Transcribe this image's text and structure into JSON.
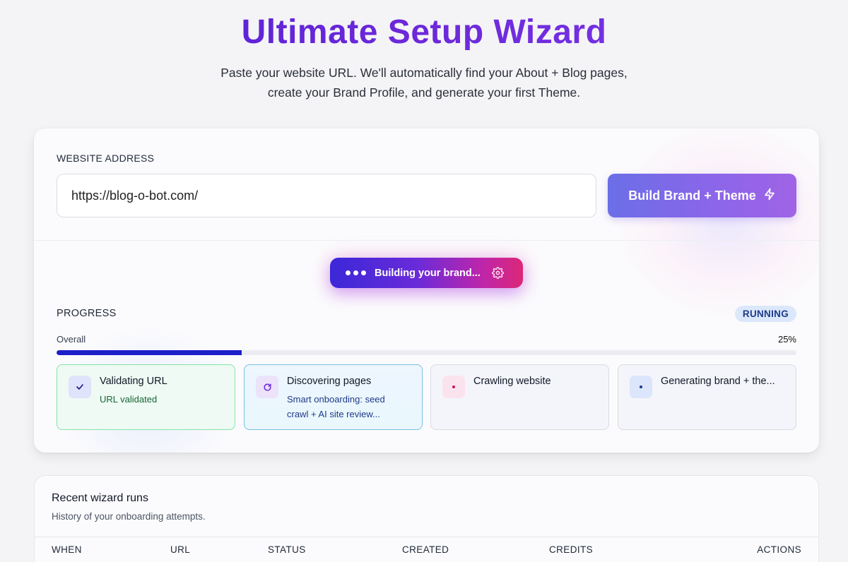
{
  "header": {
    "title": "Ultimate Setup Wizard",
    "subtitle_line1": "Paste your website URL. We'll automatically find your About + Blog pages,",
    "subtitle_line2": "create your Brand Profile, and generate your first Theme."
  },
  "form": {
    "label": "WEBSITE ADDRESS",
    "url_value": "https://blog-o-bot.com/",
    "submit_label": "Build Brand + Theme",
    "submit_icon": "lightning-bolt-icon"
  },
  "status": {
    "building_text": "Building your brand...",
    "building_icon": "gear-icon"
  },
  "progress": {
    "label": "PROGRESS",
    "badge": "RUNNING",
    "overall_label": "Overall",
    "overall_percent_text": "25%",
    "overall_fraction": 0.25
  },
  "steps": [
    {
      "title": "Validating URL",
      "detail": "URL validated",
      "state": "done",
      "icon": "checkmark-icon"
    },
    {
      "title": "Discovering pages",
      "detail": "Smart onboarding: seed crawl + AI site review...",
      "state": "active",
      "icon": "refresh-icon"
    },
    {
      "title": "Crawling website",
      "detail": "",
      "state": "pending",
      "icon": "dot-icon"
    },
    {
      "title": "Generating brand + the...",
      "detail": "",
      "state": "pending",
      "icon": "dot-icon"
    }
  ],
  "recent_runs": {
    "title": "Recent wizard runs",
    "subtitle": "History of your onboarding attempts.",
    "columns": [
      "WHEN",
      "URL",
      "STATUS",
      "CREATED",
      "CREDITS",
      "ACTIONS"
    ]
  },
  "colors": {
    "title_gradient_start": "#4f1fd6",
    "title_gradient_end": "#7c3aed",
    "button_gradient_start": "#6b6ee8",
    "button_gradient_end": "#a063e6",
    "progress_fill": "#1d1fc9",
    "done_border": "#86e2a9",
    "active_border": "#76c1e0"
  }
}
